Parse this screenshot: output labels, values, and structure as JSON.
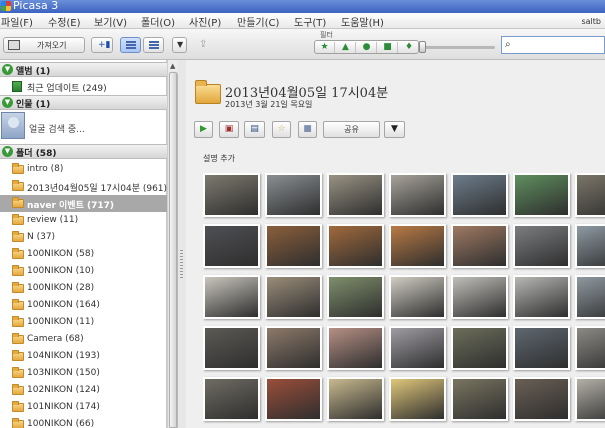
{
  "window": {
    "title": "Picasa 3",
    "user": "saltb"
  },
  "menu": [
    "파일(F)",
    "수정(E)",
    "보기(V)",
    "폴더(O)",
    "사진(P)",
    "만들기(C)",
    "도구(T)",
    "도움말(H)"
  ],
  "toolbar": {
    "import_label": "가져오기",
    "filter_label": "필터",
    "filters": [
      {
        "icon": "star-icon",
        "glyph": "★"
      },
      {
        "icon": "upload-icon",
        "glyph": "▲"
      },
      {
        "icon": "person-icon",
        "glyph": "●"
      },
      {
        "icon": "video-icon",
        "glyph": "■"
      },
      {
        "icon": "location-icon",
        "glyph": "♦"
      }
    ],
    "search_placeholder": ""
  },
  "sidebar": {
    "albums": {
      "label": "앨범 (1)",
      "items": [
        {
          "label": "최근 업데이트 (249)"
        }
      ]
    },
    "people": {
      "label": "인물 (1)",
      "face_label": "얼굴 검색 중..."
    },
    "folders": {
      "label": "폴더 (58)",
      "items": [
        {
          "label": "intro (8)",
          "selected": false
        },
        {
          "label": "2013년04월05일 17시04분 (961)",
          "selected": false
        },
        {
          "label": "naver 이벤트 (717)",
          "selected": true
        },
        {
          "label": "review (11)",
          "selected": false
        },
        {
          "label": "N (37)",
          "selected": false
        },
        {
          "label": "100NIKON (58)",
          "selected": false
        },
        {
          "label": "100NIKON (10)",
          "selected": false
        },
        {
          "label": "100NIKON (28)",
          "selected": false
        },
        {
          "label": "100NIKON (164)",
          "selected": false
        },
        {
          "label": "100NIKON (11)",
          "selected": false
        },
        {
          "label": "Camera (68)",
          "selected": false
        },
        {
          "label": "104NIKON (193)",
          "selected": false
        },
        {
          "label": "103NIKON (150)",
          "selected": false
        },
        {
          "label": "102NIKON (124)",
          "selected": false
        },
        {
          "label": "101NIKON (174)",
          "selected": false
        },
        {
          "label": "100NIKON (66)",
          "selected": false
        }
      ]
    }
  },
  "main": {
    "folder_title": "2013년04월05일 17시04분",
    "folder_date": "2013년 3월 21일 목요일",
    "share_label": "공유",
    "description_label": "설명 추가",
    "thumbnail_colors": [
      [
        "#7d7a6e",
        "#8a8f93",
        "#9a9384",
        "#a7a39a",
        "#6d7d8c",
        "#5f8f5e",
        "#7b7668"
      ],
      [
        "#4f5054",
        "#8b5f3b",
        "#a16a3c",
        "#b97a44",
        "#9f7a63",
        "#7b7e80",
        "#8e9aa3"
      ],
      [
        "#c9c6bd",
        "#9b8d7a",
        "#7f8f6c",
        "#d1cdc3",
        "#c1bfba",
        "#b7b8b4",
        "#8f99a0"
      ],
      [
        "#5c5a55",
        "#8d7a6a",
        "#b69085",
        "#9f9ca3",
        "#6c6e5a",
        "#5e6770",
        "#8b8a85"
      ],
      [
        "#6f6c63",
        "#9b4e3a",
        "#c8b98e",
        "#e0c77a",
        "#7a7560",
        "#6a5f55",
        "#b4b0a7"
      ]
    ]
  }
}
